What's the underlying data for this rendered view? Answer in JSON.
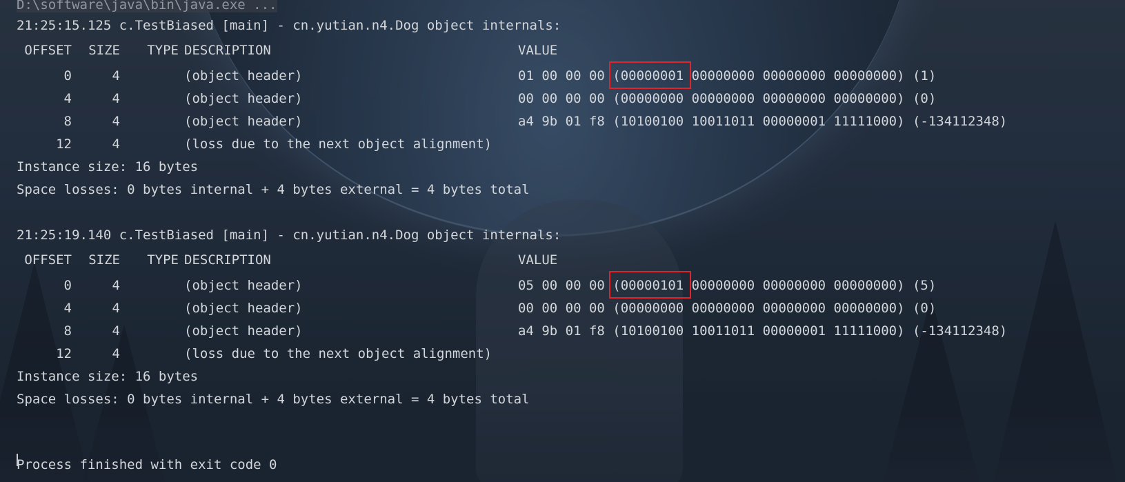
{
  "console": {
    "command": "D:\\software\\java\\bin\\java.exe ...",
    "blocks": [
      {
        "title": "21:25:15.125 c.TestBiased [main] - cn.yutian.n4.Dog object internals:",
        "columns": {
          "offset": "OFFSET",
          "size": "SIZE",
          "type": "TYPE",
          "description": "DESCRIPTION",
          "value": "VALUE"
        },
        "rows": [
          {
            "offset": "0",
            "size": "4",
            "type": "",
            "description": "(object header)",
            "value": "01 00 00 00 (00000001 00000000 00000000 00000000) (1)"
          },
          {
            "offset": "4",
            "size": "4",
            "type": "",
            "description": "(object header)",
            "value": "00 00 00 00 (00000000 00000000 00000000 00000000) (0)"
          },
          {
            "offset": "8",
            "size": "4",
            "type": "",
            "description": "(object header)",
            "value": "a4 9b 01 f8 (10100100 10011011 00000001 11111000) (-134112348)"
          },
          {
            "offset": "12",
            "size": "4",
            "type": "",
            "description": "(loss due to the next object alignment)",
            "value": ""
          }
        ],
        "instance_size": "Instance size: 16 bytes",
        "space_losses": "Space losses: 0 bytes internal + 4 bytes external = 4 bytes total"
      },
      {
        "title": "21:25:19.140 c.TestBiased [main] - cn.yutian.n4.Dog object internals:",
        "columns": {
          "offset": "OFFSET",
          "size": "SIZE",
          "type": "TYPE",
          "description": "DESCRIPTION",
          "value": "VALUE"
        },
        "rows": [
          {
            "offset": "0",
            "size": "4",
            "type": "",
            "description": "(object header)",
            "value": "05 00 00 00 (00000101 00000000 00000000 00000000) (5)"
          },
          {
            "offset": "4",
            "size": "4",
            "type": "",
            "description": "(object header)",
            "value": "00 00 00 00 (00000000 00000000 00000000 00000000) (0)"
          },
          {
            "offset": "8",
            "size": "4",
            "type": "",
            "description": "(object header)",
            "value": "a4 9b 01 f8 (10100100 10011011 00000001 11111000) (-134112348)"
          },
          {
            "offset": "12",
            "size": "4",
            "type": "",
            "description": "(loss due to the next object alignment)",
            "value": ""
          }
        ],
        "instance_size": "Instance size: 16 bytes",
        "space_losses": "Space losses: 0 bytes internal + 4 bytes external = 4 bytes total"
      }
    ],
    "exit_message": "Process finished with exit code 0"
  },
  "colors": {
    "text": "#d3d6da",
    "highlight": "#e0242a"
  }
}
